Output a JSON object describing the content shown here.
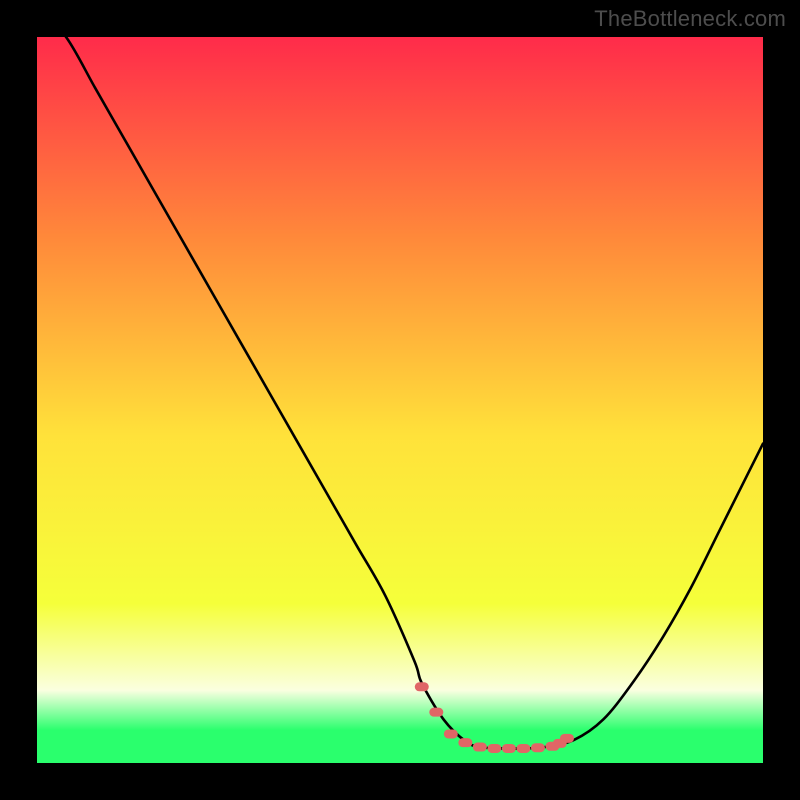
{
  "watermark": "TheBottleneck.com",
  "colors": {
    "bg": "#000000",
    "gradient_top": "#ff2b4a",
    "gradient_mid_upper": "#ff8a3a",
    "gradient_mid": "#ffe23a",
    "gradient_mid_lower": "#f5ff3a",
    "gradient_band_pale": "#faffe0",
    "gradient_bottom": "#2aff6d",
    "curve": "#000000",
    "marker": "#e06666"
  },
  "chart_data": {
    "type": "line",
    "title": "",
    "xlabel": "",
    "ylabel": "",
    "xlim": [
      0,
      100
    ],
    "ylim": [
      0,
      100
    ],
    "series": [
      {
        "name": "bottleneck-curve",
        "x": [
          0,
          4,
          8,
          12,
          16,
          20,
          24,
          28,
          32,
          36,
          40,
          44,
          48,
          52,
          53,
          56,
          59,
          61,
          64,
          67,
          70,
          74,
          78,
          82,
          86,
          90,
          94,
          98,
          100
        ],
        "y": [
          104,
          100,
          93,
          86,
          79,
          72,
          65,
          58,
          51,
          44,
          37,
          30,
          23,
          14,
          11,
          6,
          3,
          2.2,
          2.0,
          2.0,
          2.2,
          3.2,
          6,
          11,
          17,
          24,
          32,
          40,
          44
        ]
      }
    ],
    "markers": {
      "name": "flat-region",
      "x": [
        53,
        55,
        57,
        59,
        61,
        63,
        65,
        67,
        69,
        71,
        72,
        73
      ],
      "y": [
        10.5,
        7.0,
        4.0,
        2.8,
        2.2,
        2.0,
        2.0,
        2.0,
        2.1,
        2.3,
        2.7,
        3.4
      ]
    },
    "gradient_stops": [
      {
        "offset": 0.0,
        "color": "#ff2b4a"
      },
      {
        "offset": 0.28,
        "color": "#ff8a3a"
      },
      {
        "offset": 0.55,
        "color": "#ffe23a"
      },
      {
        "offset": 0.78,
        "color": "#f5ff3a"
      },
      {
        "offset": 0.9,
        "color": "#faffe0"
      },
      {
        "offset": 0.955,
        "color": "#2aff6d"
      },
      {
        "offset": 1.0,
        "color": "#2aff6d"
      }
    ]
  }
}
